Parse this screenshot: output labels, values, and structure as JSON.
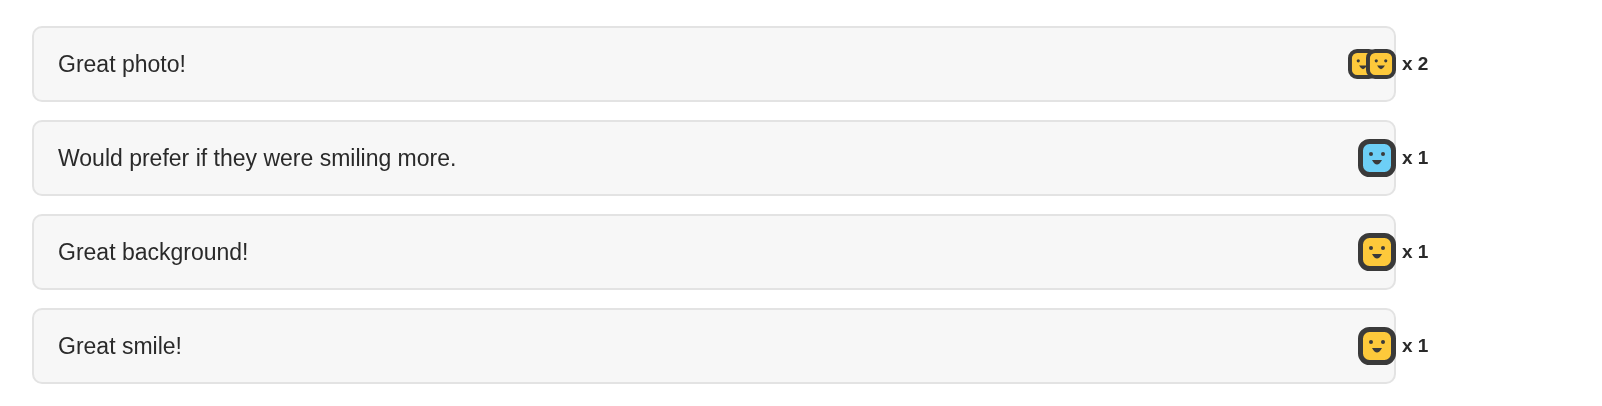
{
  "comments": [
    {
      "text": "Great photo!",
      "reactions": [
        {
          "color": "#fdc93b"
        },
        {
          "color": "#fdc93b"
        }
      ],
      "count": "x 2"
    },
    {
      "text": "Would prefer if they were smiling more.",
      "reactions": [
        {
          "color": "#6dcff6"
        }
      ],
      "count": "x 1"
    },
    {
      "text": "Great background!",
      "reactions": [
        {
          "color": "#fdc93b"
        }
      ],
      "count": "x 1"
    },
    {
      "text": "Great smile!",
      "reactions": [
        {
          "color": "#fdc93b"
        }
      ],
      "count": "x 1"
    }
  ]
}
